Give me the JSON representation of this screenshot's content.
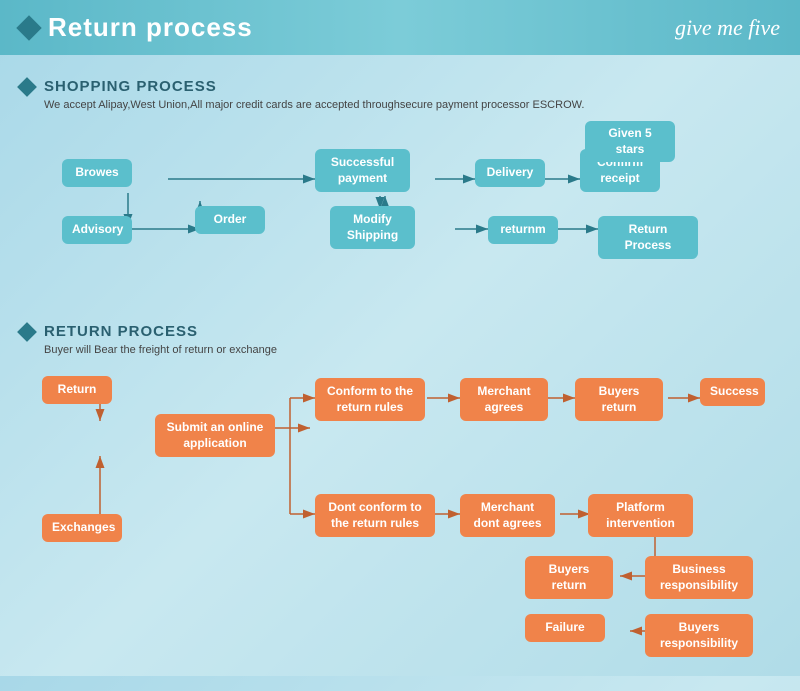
{
  "header": {
    "title": "Return process",
    "logo": "give me five"
  },
  "shopping_section": {
    "title": "SHOPPING PROCESS",
    "description": "We accept Alipay,West Union,All major credit cards are accepted throughsecure payment processor ESCROW.",
    "boxes": {
      "browes": "Browes",
      "order": "Order",
      "advisory": "Advisory",
      "modify_shipping": "Modify\nShipping",
      "returnm": "returnm",
      "return_process": "Return Process",
      "successful_payment": "Successful\npayment",
      "delivery": "Delivery",
      "confirm_receipt": "Confirm\nreceipt",
      "given_5_stars": "Given 5 stars"
    }
  },
  "return_section": {
    "title": "RETURN PROCESS",
    "description": "Buyer will Bear the freight of return or exchange",
    "boxes": {
      "return": "Return",
      "exchanges": "Exchanges",
      "submit_online": "Submit an online\napplication",
      "conform_rules": "Conform to the\nreturn rules",
      "dont_conform_rules": "Dont conform to the\nreturn rules",
      "merchant_agrees": "Merchant\nagrees",
      "merchant_dont_agrees": "Merchant\ndont agrees",
      "buyers_return_1": "Buyers\nreturn",
      "buyers_return_2": "Buyers\nreturn",
      "platform_intervention": "Platform\nintervention",
      "success": "Success",
      "business_responsibility": "Business\nresponsibility",
      "buyers_responsibility": "Buyers\nresponsibility",
      "failure": "Failure"
    }
  }
}
